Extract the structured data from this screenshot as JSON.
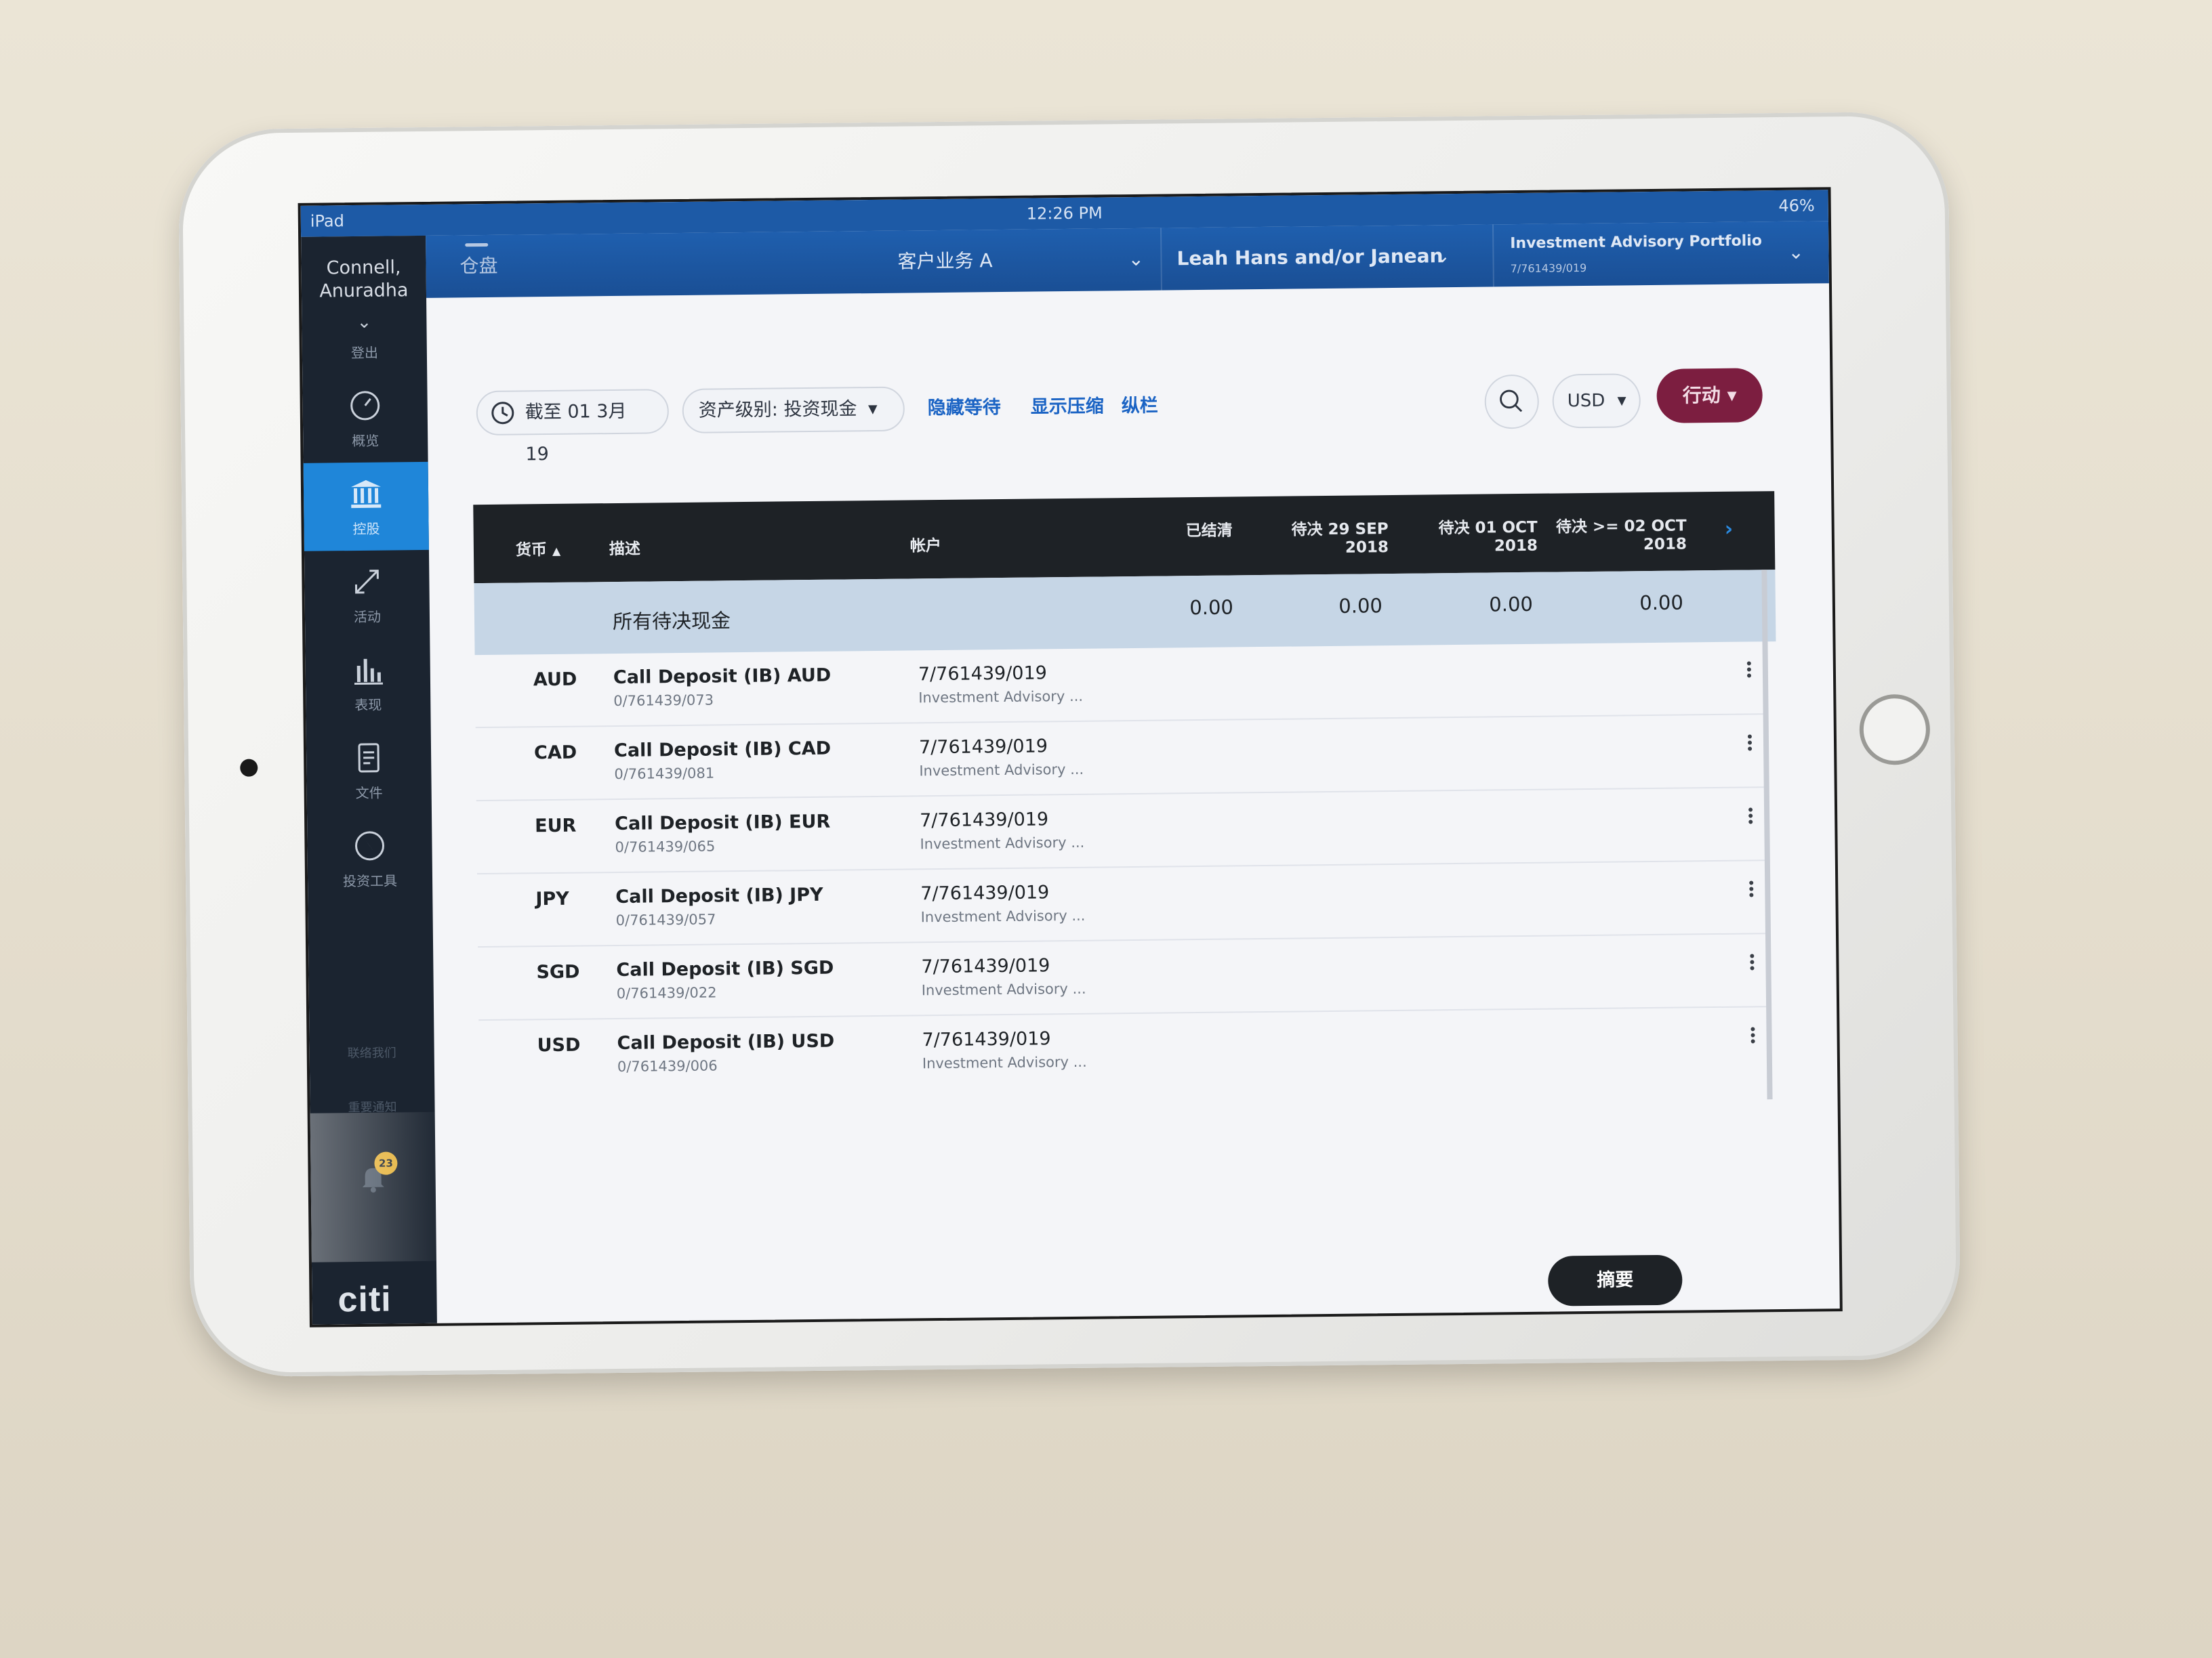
{
  "status_bar": {
    "device": "iPad",
    "time": "12:26 PM",
    "battery": "46%"
  },
  "sidebar": {
    "user_name": "Connell,\nAnuradha",
    "logout": "登出",
    "items": [
      {
        "label": "概览",
        "icon": "gauge-icon"
      },
      {
        "label": "控股",
        "icon": "bank-icon",
        "active": true
      },
      {
        "label": "活动",
        "icon": "arrows-diagonal-icon"
      },
      {
        "label": "表现",
        "icon": "bar-chart-icon"
      },
      {
        "label": "文件",
        "icon": "document-icon"
      },
      {
        "label": "投资工具",
        "icon": "compass-icon"
      }
    ],
    "contact": "联络我们",
    "notice": "重要通知",
    "bell_badge": "23",
    "logo": "citi"
  },
  "topbar": {
    "home": "仓盘",
    "client": "客户业务 A",
    "person": "Leah  Hans and/or Janean",
    "portfolio_name": "Investment Advisory Portfolio",
    "portfolio_id": "7/761439/019"
  },
  "filters": {
    "date": "截至 01 3月 19",
    "asset_level": "资产级别: 投资现金",
    "hide_pending": "隐藏等待",
    "show_compressed": "显示压缩",
    "columns": "纵栏",
    "currency": "USD",
    "action": "行动"
  },
  "table": {
    "headers": {
      "currency": "货币",
      "description": "描述",
      "account": "帐户",
      "settled": "已结清",
      "pending1_a": "待决 29 SEP",
      "pending1_b": "2018",
      "pending2_a": "待决 01 OCT",
      "pending2_b": "2018",
      "pending3_a": "待决 >= 02 OCT",
      "pending3_b": "2018"
    },
    "summary": {
      "label": "所有待决现金",
      "settled": "0.00",
      "pending1": "0.00",
      "pending2": "0.00",
      "pending3": "0.00"
    },
    "rows": [
      {
        "currency": "AUD",
        "description": "Call Deposit (IB) AUD",
        "sub": "0/761439/073",
        "account": "7/761439/019",
        "account_name": "Investment Advisory ..."
      },
      {
        "currency": "CAD",
        "description": "Call Deposit (IB) CAD",
        "sub": "0/761439/081",
        "account": "7/761439/019",
        "account_name": "Investment Advisory ..."
      },
      {
        "currency": "EUR",
        "description": "Call Deposit (IB) EUR",
        "sub": "0/761439/065",
        "account": "7/761439/019",
        "account_name": "Investment Advisory ..."
      },
      {
        "currency": "JPY",
        "description": "Call Deposit (IB) JPY",
        "sub": "0/761439/057",
        "account": "7/761439/019",
        "account_name": "Investment Advisory ..."
      },
      {
        "currency": "SGD",
        "description": "Call Deposit (IB) SGD",
        "sub": "0/761439/022",
        "account": "7/761439/019",
        "account_name": "Investment Advisory ..."
      },
      {
        "currency": "USD",
        "description": "Call Deposit (IB) USD",
        "sub": "0/761439/006",
        "account": "7/761439/019",
        "account_name": "Investment Advisory ..."
      }
    ]
  },
  "summary_button": "摘要",
  "colors": {
    "sidebar_bg": "#1b2430",
    "topbar_bg": "#1f5fae",
    "active_nav": "#1f86d9",
    "action_btn": "#7c1e40",
    "table_head": "#1e2226",
    "summary_row": "#c6d6e6",
    "link": "#1a63c4"
  }
}
